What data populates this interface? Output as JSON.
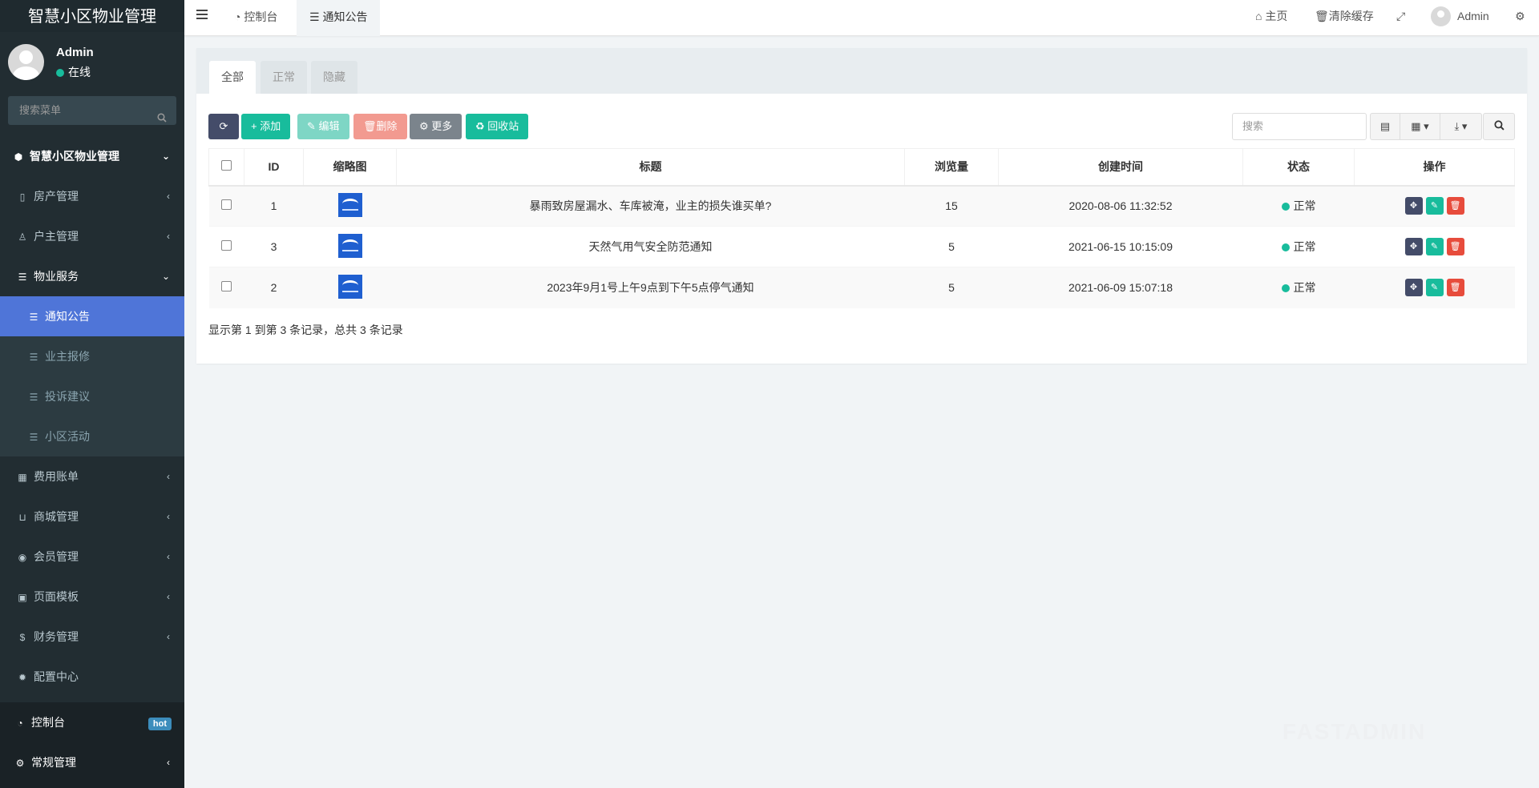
{
  "app": {
    "title": "智慧小区物业管理"
  },
  "user": {
    "name": "Admin",
    "status": "在线"
  },
  "sidebar": {
    "search_placeholder": "搜索菜单",
    "items": [
      {
        "label": "智慧小区物业管理",
        "icon": "cubes-icon"
      },
      {
        "label": "房产管理",
        "icon": "building-icon"
      },
      {
        "label": "户主管理",
        "icon": "user-icon"
      },
      {
        "label": "物业服务",
        "icon": "list-icon"
      },
      {
        "label": "通知公告",
        "icon": "list-icon"
      },
      {
        "label": "业主报修",
        "icon": "list-icon"
      },
      {
        "label": "投诉建议",
        "icon": "list-icon"
      },
      {
        "label": "小区活动",
        "icon": "list-icon"
      },
      {
        "label": "费用账单",
        "icon": "calendar-icon"
      },
      {
        "label": "商城管理",
        "icon": "basket-icon"
      },
      {
        "label": "会员管理",
        "icon": "user-circle-icon"
      },
      {
        "label": "页面模板",
        "icon": "template-icon"
      },
      {
        "label": "财务管理",
        "icon": "dollar-icon"
      },
      {
        "label": "配置中心",
        "icon": "gear-icon"
      }
    ],
    "bottom": [
      {
        "label": "控制台",
        "badge": "hot",
        "icon": "dashboard-icon"
      },
      {
        "label": "常规管理",
        "icon": "cogs-icon"
      }
    ]
  },
  "topbar": {
    "tabs": [
      {
        "label": "控制台",
        "icon": "dashboard-icon"
      },
      {
        "label": "通知公告",
        "icon": "list-icon"
      }
    ],
    "home": "主页",
    "clear_cache": "清除缓存",
    "user": "Admin"
  },
  "panel": {
    "tabs": [
      "全部",
      "正常",
      "隐藏"
    ],
    "toolbar": {
      "add": "添加",
      "edit": "编辑",
      "delete": "删除",
      "more": "更多",
      "recycle": "回收站"
    },
    "search_placeholder": "搜索",
    "columns": [
      "ID",
      "缩略图",
      "标题",
      "浏览量",
      "创建时间",
      "状态",
      "操作"
    ],
    "rows": [
      {
        "id": "1",
        "title": "暴雨致房屋漏水、车库被淹，业主的损失谁买单?",
        "views": "15",
        "created": "2020-08-06 11:32:52",
        "status": "正常"
      },
      {
        "id": "3",
        "title": "天然气用气安全防范通知",
        "views": "5",
        "created": "2021-06-15 10:15:09",
        "status": "正常"
      },
      {
        "id": "2",
        "title": "2023年9月1号上午9点到下午5点停气通知",
        "views": "5",
        "created": "2021-06-09 15:07:18",
        "status": "正常"
      }
    ],
    "pager": "显示第 1 到第 3 条记录，总共 3 条记录"
  },
  "colors": {
    "accent": "#4f75d8",
    "success": "#18bc9c",
    "danger": "#e74c3c",
    "sidebar": "#222d32"
  }
}
